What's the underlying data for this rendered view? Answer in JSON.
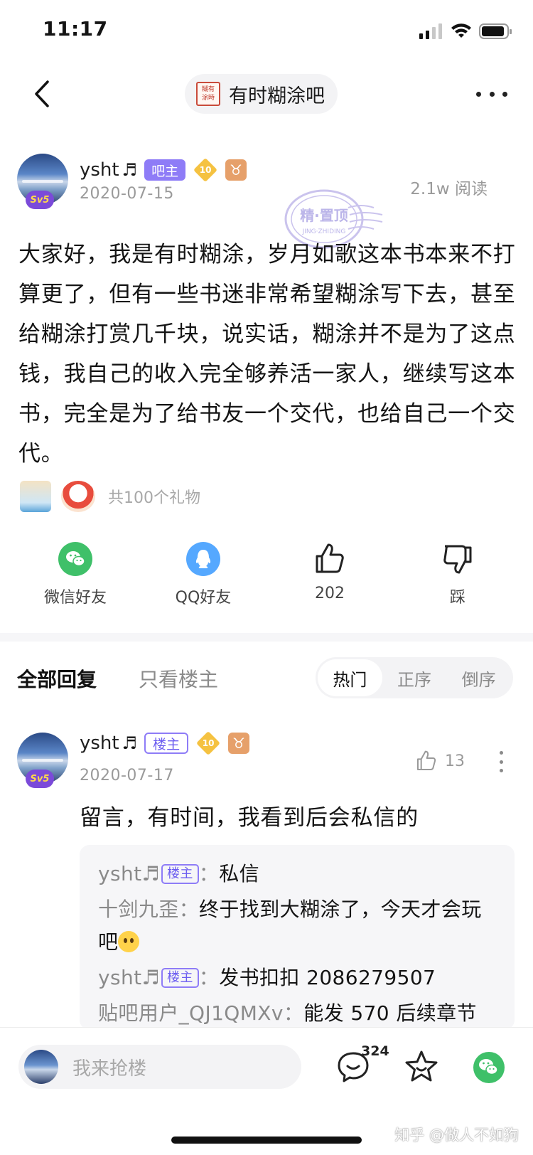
{
  "status_bar": {
    "time": "11:17"
  },
  "nav": {
    "forum_name": "有时糊涂吧",
    "forum_avatar_text": "糊有涂時"
  },
  "post": {
    "author": "ysht",
    "author_note": "♬",
    "owner_tag": "吧主",
    "level": "10",
    "zodiac": "♉",
    "avatar_badge": "Sv5",
    "date": "2020-07-15",
    "read_count": "2.1w 阅读",
    "body": "大家好，我是有时糊涂，岁月如歌这本书本来不打算更了，但有一些书迷非常希望糊涂写下去，甚至给糊涂打赏几千块，说实话，糊涂并不是为了这点钱，我自己的收入完全够养活一家人，继续写这本书，完全是为了给书友一个交代，也给自己一个交代。",
    "gift_count": "共100个礼物",
    "watermark_stamp": {
      "main": "精·置顶",
      "sub": "JING·ZHIDING"
    }
  },
  "actions": {
    "wechat_label": "微信好友",
    "qq_label": "QQ好友",
    "like_count": "202",
    "dislike_label": "踩"
  },
  "reply_tabs": {
    "all": "全部回复",
    "owner_only": "只看楼主",
    "sort": [
      "热门",
      "正序",
      "倒序"
    ],
    "active_sort": "热门"
  },
  "reply": {
    "author": "ysht",
    "author_note": "♬",
    "tag": "楼主",
    "level": "10",
    "zodiac": "♉",
    "avatar_badge": "Sv5",
    "date": "2020-07-17",
    "like_count": "13",
    "text": "留言，有时间，我看到后会私信的",
    "sub_replies": [
      {
        "name": "ysht♬",
        "tag": "楼主",
        "sep": "：",
        "text": "私信"
      },
      {
        "name": "十剑九歪",
        "sep": "：",
        "text": "终于找到大糊涂了，今天才会玩吧"
      },
      {
        "name": "ysht♬",
        "tag": "楼主",
        "sep": "：",
        "text": "发书扣扣 2086279507"
      },
      {
        "name": "贴吧用户_QJ1QMXv",
        "sep": "：",
        "text": "能发 570 后续章节"
      }
    ]
  },
  "bottom_bar": {
    "placeholder": "我来抢楼",
    "comment_count": "324"
  },
  "corner_watermark": "知乎 @做人不如狗"
}
